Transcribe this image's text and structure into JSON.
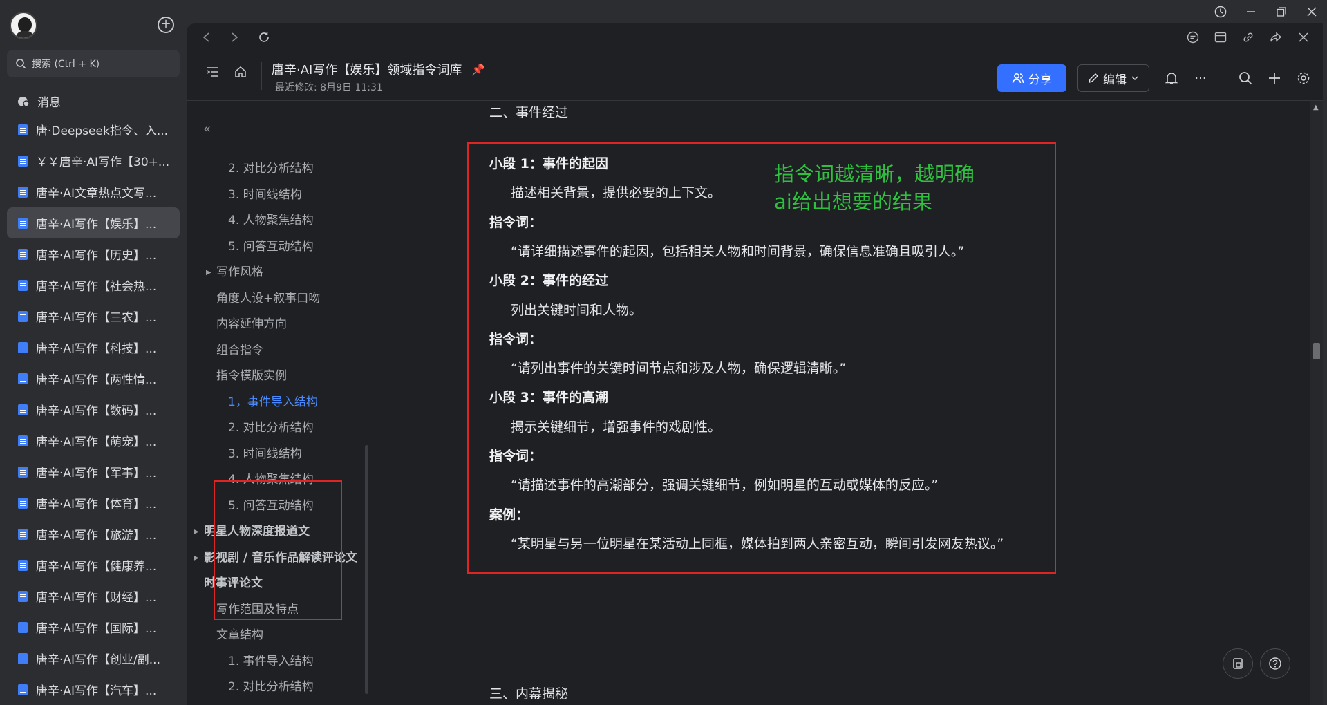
{
  "sidebar": {
    "search_placeholder": "搜索 (Ctrl + K)",
    "messages_label": "消息",
    "docs": [
      {
        "label": "唐·Deepseek指令、入...",
        "active": false
      },
      {
        "label": "￥￥唐辛·AI写作【30+...",
        "active": false
      },
      {
        "label": "唐辛·AI文章热点文写...",
        "active": false
      },
      {
        "label": "唐辛·AI写作【娱乐】...",
        "active": true
      },
      {
        "label": "唐辛·AI写作【历史】...",
        "active": false
      },
      {
        "label": "唐辛·AI写作【社会热...",
        "active": false
      },
      {
        "label": "唐辛·AI写作【三农】...",
        "active": false
      },
      {
        "label": "唐辛·AI写作【科技】...",
        "active": false
      },
      {
        "label": "唐辛·AI写作【两性情...",
        "active": false
      },
      {
        "label": "唐辛·AI写作【数码】...",
        "active": false
      },
      {
        "label": "唐辛·AI写作【萌宠】...",
        "active": false
      },
      {
        "label": "唐辛·AI写作【军事】...",
        "active": false
      },
      {
        "label": "唐辛·AI写作【体育】...",
        "active": false
      },
      {
        "label": "唐辛·AI写作【旅游】...",
        "active": false
      },
      {
        "label": "唐辛·AI写作【健康养...",
        "active": false
      },
      {
        "label": "唐辛·AI写作【财经】...",
        "active": false
      },
      {
        "label": "唐辛·AI写作【国际】...",
        "active": false
      },
      {
        "label": "唐辛·AI写作【创业/副...",
        "active": false
      },
      {
        "label": "唐辛·AI写作【汽车】...",
        "active": false
      }
    ]
  },
  "header": {
    "title": "唐辛·AI写作【娱乐】领域指令词库",
    "subtitle": "最近修改: 8月9日 11:31",
    "share_label": "分享",
    "edit_label": "编辑"
  },
  "outline": {
    "items": [
      {
        "label": "2. 对比分析结构",
        "level": "l3",
        "active": false,
        "tri": false
      },
      {
        "label": "3. 时间线结构",
        "level": "l3",
        "active": false,
        "tri": false
      },
      {
        "label": "4. 人物聚焦结构",
        "level": "l3",
        "active": false,
        "tri": false
      },
      {
        "label": "5. 问答互动结构",
        "level": "l3",
        "active": false,
        "tri": false
      },
      {
        "label": "写作风格",
        "level": "l2",
        "active": false,
        "tri": true
      },
      {
        "label": "角度人设+叙事口吻",
        "level": "l2",
        "active": false,
        "tri": false
      },
      {
        "label": "内容延伸方向",
        "level": "l2",
        "active": false,
        "tri": false
      },
      {
        "label": "组合指令",
        "level": "l2",
        "active": false,
        "tri": false
      },
      {
        "label": "指令模版实例",
        "level": "l2",
        "active": false,
        "tri": false
      },
      {
        "label": "1，事件导入结构",
        "level": "l3",
        "active": true,
        "tri": false
      },
      {
        "label": "2. 对比分析结构",
        "level": "l3",
        "active": false,
        "tri": false
      },
      {
        "label": "3. 时间线结构",
        "level": "l3",
        "active": false,
        "tri": false
      },
      {
        "label": "4. 人物聚焦结构",
        "level": "l3",
        "active": false,
        "tri": false
      },
      {
        "label": "5. 问答互动结构",
        "level": "l3",
        "active": false,
        "tri": false
      },
      {
        "label": "明星人物深度报道文",
        "level": "l1",
        "active": false,
        "tri": true
      },
      {
        "label": "影视剧 / 音乐作品解读评论文",
        "level": "l1",
        "active": false,
        "tri": true
      },
      {
        "label": "时事评论文",
        "level": "l1",
        "active": false,
        "tri": false
      },
      {
        "label": "写作范围及特点",
        "level": "l2",
        "active": false,
        "tri": false
      },
      {
        "label": "文章结构",
        "level": "l2",
        "active": false,
        "tri": false
      },
      {
        "label": "1. 事件导入结构",
        "level": "l3",
        "active": false,
        "tri": false
      },
      {
        "label": "2. 对比分析结构",
        "level": "l3",
        "active": false,
        "tri": false
      }
    ]
  },
  "content": {
    "section_top": "二、事件经过",
    "note_line1": "指令词越清晰，越明确",
    "note_line2": "ai给出想要的结果",
    "blocks": [
      {
        "text": "小段 1：事件的起因",
        "bold": true,
        "indent": false
      },
      {
        "text": "描述相关背景，提供必要的上下文。",
        "bold": false,
        "indent": true
      },
      {
        "text": "指令词：",
        "bold": true,
        "indent": false
      },
      {
        "text": "“请详细描述事件的起因，包括相关人物和时间背景，确保信息准确且吸引人。”",
        "bold": false,
        "indent": true
      },
      {
        "text": "小段 2：事件的经过",
        "bold": true,
        "indent": false
      },
      {
        "text": "列出关键时间和人物。",
        "bold": false,
        "indent": true
      },
      {
        "text": "指令词：",
        "bold": true,
        "indent": false
      },
      {
        "text": "“请列出事件的关键时间节点和涉及人物，确保逻辑清晰。”",
        "bold": false,
        "indent": true
      },
      {
        "text": "小段 3：事件的高潮",
        "bold": true,
        "indent": false
      },
      {
        "text": "揭示关键细节，增强事件的戏剧性。",
        "bold": false,
        "indent": true
      },
      {
        "text": "指令词：",
        "bold": true,
        "indent": false
      },
      {
        "text": "“请描述事件的高潮部分，强调关键细节，例如明星的互动或媒体的反应。”",
        "bold": false,
        "indent": true
      },
      {
        "text": "案例：",
        "bold": true,
        "indent": false
      },
      {
        "text": "“某明星与另一位明星在某活动上同框，媒体拍到两人亲密互动，瞬间引发网友热议。”",
        "bold": false,
        "indent": true
      }
    ],
    "section_next": "三、内幕揭秘"
  },
  "colors": {
    "accent": "#3370ff",
    "highlight_box": "#e02424",
    "note_green": "#2fc03f",
    "active_outline": "#4b8bff"
  }
}
